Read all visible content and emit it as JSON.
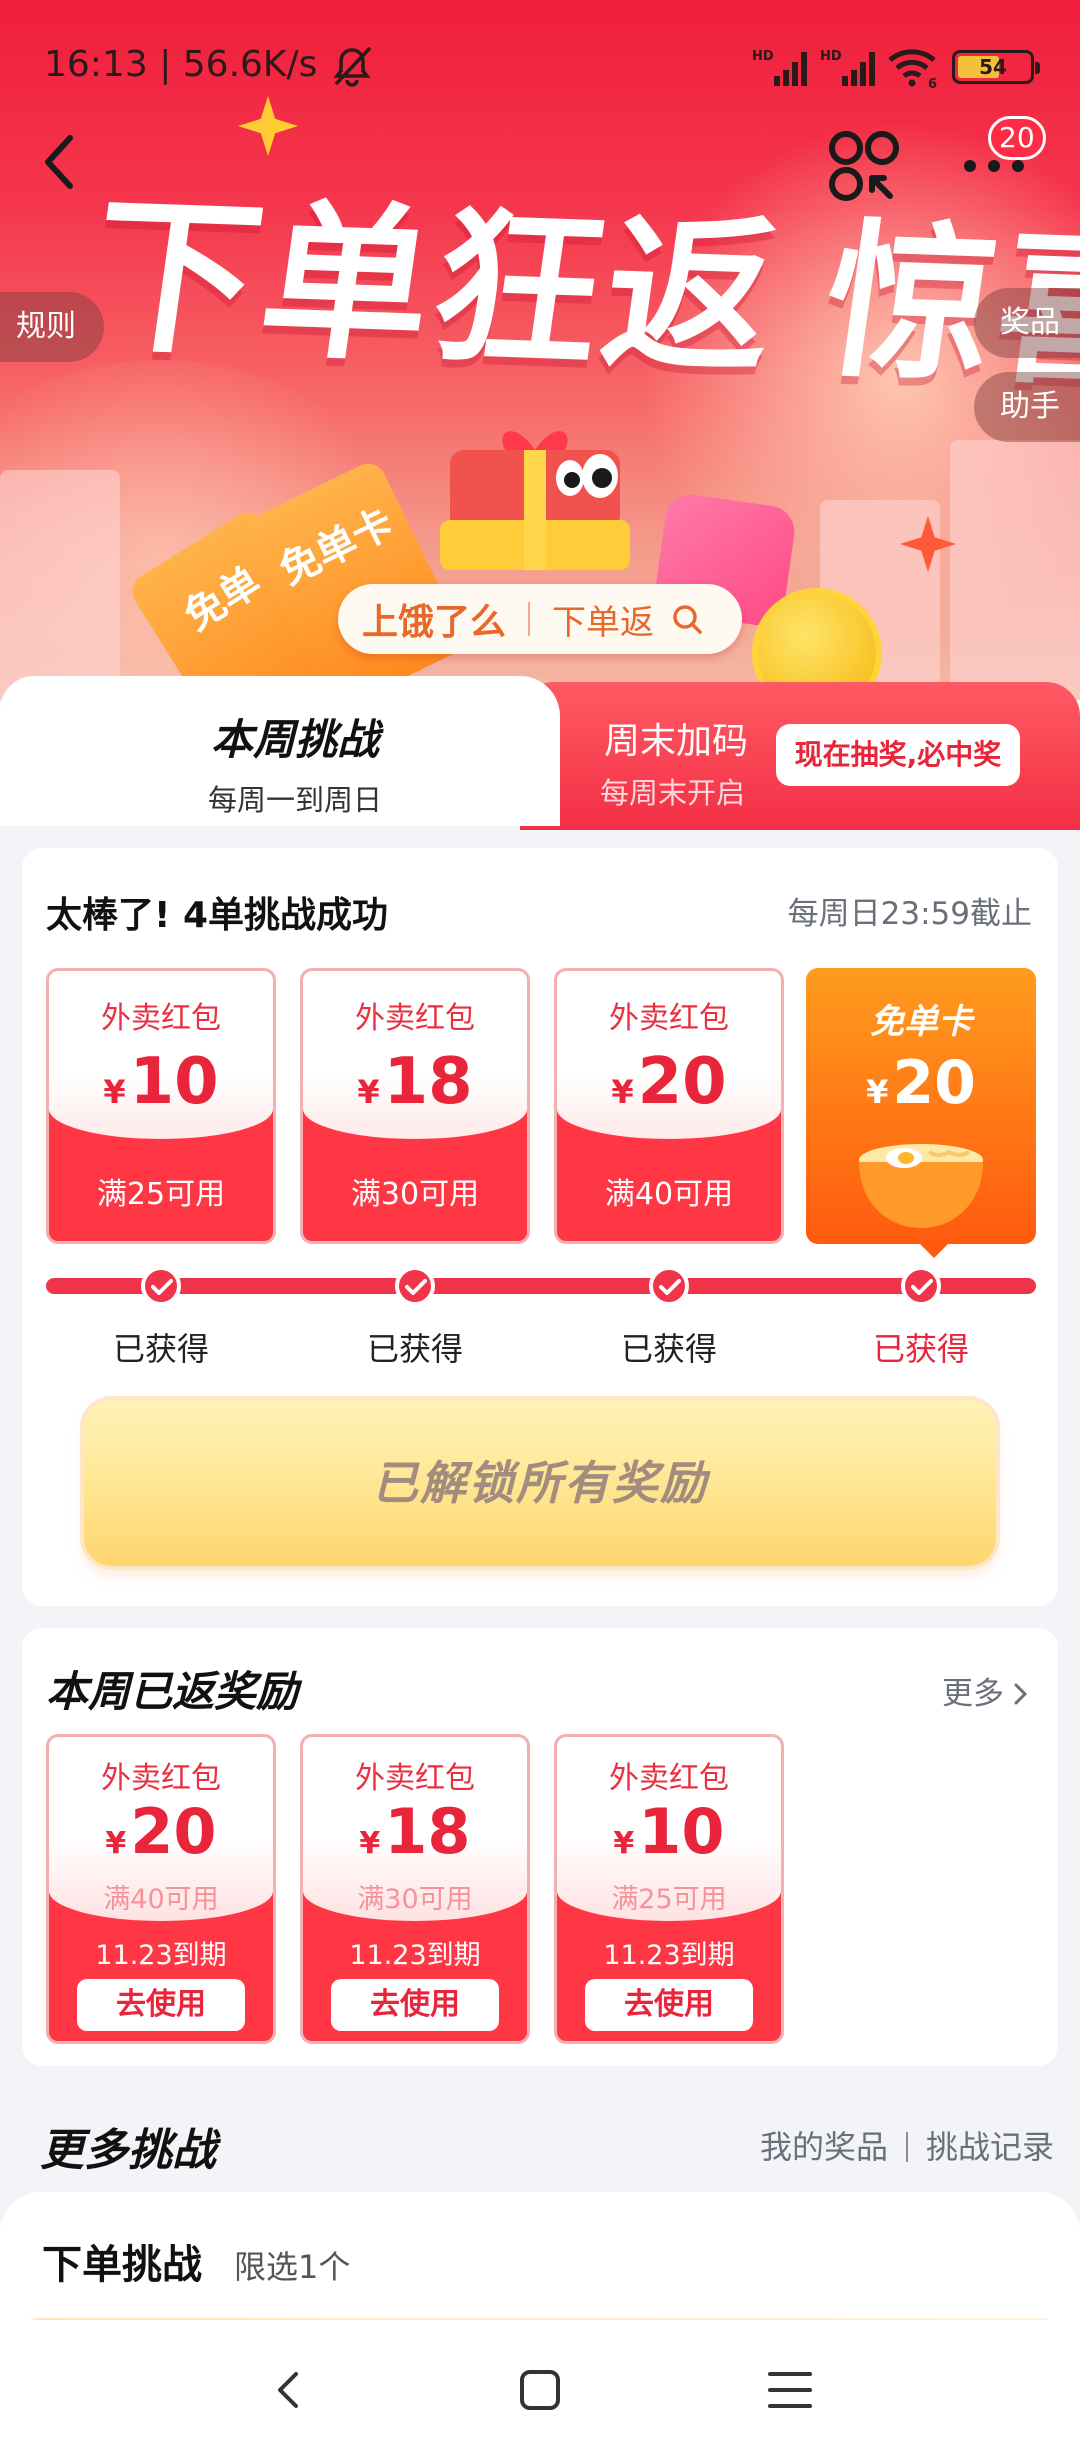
{
  "status_bar": {
    "time_speed": "16:13 | 56.6K/s",
    "signal_1_label": "HD",
    "signal_2_label": "HD",
    "wifi_label": "6",
    "battery": "54"
  },
  "header": {
    "notification_count": "20",
    "hero_title_left": "下单狂返",
    "hero_title_right": "惊喜不断",
    "side_rules": "规则",
    "side_prizes": "奖品",
    "side_helper": "助手",
    "ticket_text_1": "免单卡",
    "ticket_text_2": "免单",
    "search_keyword": "上饿了么",
    "search_action": "下单返"
  },
  "tabs": {
    "weekly_title": "本周挑战",
    "weekly_sub": "每周一到周日",
    "weekend_title": "周末加码",
    "weekend_sub": "每周末开启",
    "weekend_button": "现在抽奖,必中奖"
  },
  "challenge": {
    "heading": "太棒了! 4单挑战成功",
    "deadline": "每周日23:59截止",
    "currency": "¥",
    "rewards": [
      {
        "name": "外卖红包",
        "amount": "10",
        "condition": "满25可用",
        "status": "已获得"
      },
      {
        "name": "外卖红包",
        "amount": "18",
        "condition": "满30可用",
        "status": "已获得"
      },
      {
        "name": "外卖红包",
        "amount": "20",
        "condition": "满40可用",
        "status": "已获得"
      },
      {
        "name": "免单卡",
        "amount": "20",
        "status": "已获得"
      }
    ],
    "unlock_button": "已解锁所有奖励"
  },
  "returned": {
    "heading": "本周已返奖励",
    "more_link": "更多",
    "currency": "¥",
    "coupons": [
      {
        "name": "外卖红包",
        "amount": "20",
        "condition": "满40可用",
        "expiry": "11.23到期",
        "action": "去使用"
      },
      {
        "name": "外卖红包",
        "amount": "18",
        "condition": "满30可用",
        "expiry": "11.23到期",
        "action": "去使用"
      },
      {
        "name": "外卖红包",
        "amount": "10",
        "condition": "满25可用",
        "expiry": "11.23到期",
        "action": "去使用"
      }
    ]
  },
  "more_challenges": {
    "heading": "更多挑战",
    "link_prizes": "我的奖品",
    "link_records": "挑战记录",
    "order_title": "下单挑战",
    "order_sub": "限选1个"
  },
  "colors": {
    "primary_red": "#f0344a",
    "accent_orange": "#ff7a14",
    "gold": "#ffe590"
  },
  "icons": [
    "back-arrow-icon",
    "scan-icon",
    "more-dots-icon",
    "search-icon",
    "check-icon",
    "chevron-right-icon",
    "nav-back-icon",
    "nav-home-icon",
    "nav-menu-icon",
    "mute-icon",
    "signal-icon",
    "wifi-icon",
    "battery-icon"
  ]
}
